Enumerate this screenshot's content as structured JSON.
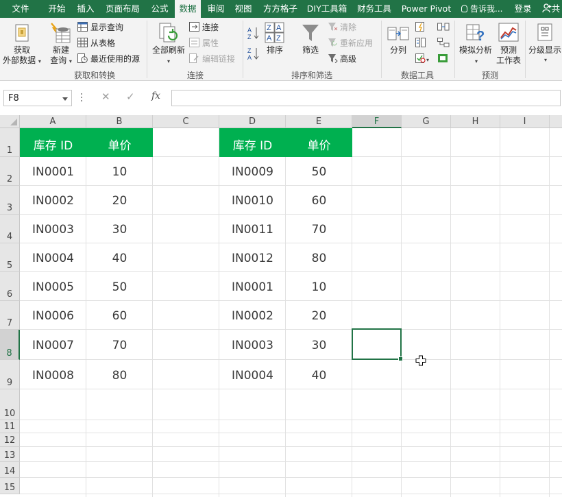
{
  "menu": {
    "tabs": [
      "文件",
      "开始",
      "插入",
      "页面布局",
      "公式",
      "数据",
      "审阅",
      "视图",
      "方方格子",
      "DIY工具箱",
      "财务工具",
      "Power Pivot"
    ],
    "active_tab": "数据",
    "tell_me": "告诉我...",
    "login": "登录",
    "share": "共"
  },
  "ribbon": {
    "get_transform": {
      "get_external": [
        "获取",
        "外部数据"
      ],
      "new_query": [
        "新建",
        "查询"
      ],
      "show_queries": "显示查询",
      "from_table": "从表格",
      "recent_sources": "最近使用的源",
      "label": "获取和转换"
    },
    "connections": {
      "refresh_all": "全部刷新",
      "connections": "连接",
      "properties": "属性",
      "edit_links": "编辑链接",
      "label": "连接"
    },
    "sort_filter": {
      "sort": "排序",
      "filter": "筛选",
      "clear": "清除",
      "reapply": "重新应用",
      "advanced": "高级",
      "label": "排序和筛选"
    },
    "data_tools": {
      "text_to_columns": "分列",
      "label": "数据工具"
    },
    "forecast": {
      "what_if": "模拟分析",
      "forecast_sheet": [
        "预测",
        "工作表"
      ],
      "label": "预测"
    },
    "outline": {
      "outline": "分级显示"
    }
  },
  "formula_bar": {
    "name_box": "F8",
    "cancel": "✕",
    "enter": "✓",
    "fx": "fx",
    "formula": ""
  },
  "sheet": {
    "columns": [
      "A",
      "B",
      "C",
      "D",
      "E",
      "F",
      "G",
      "H",
      "I"
    ],
    "rows": [
      "1",
      "2",
      "3",
      "4",
      "5",
      "6",
      "7",
      "8",
      "9",
      "10",
      "11",
      "12",
      "13",
      "14",
      "15"
    ],
    "selected_cell": "F8",
    "table1": {
      "headers": [
        "库存 ID",
        "单价"
      ],
      "rows": [
        [
          "IN0001",
          "10"
        ],
        [
          "IN0002",
          "20"
        ],
        [
          "IN0003",
          "30"
        ],
        [
          "IN0004",
          "40"
        ],
        [
          "IN0005",
          "50"
        ],
        [
          "IN0006",
          "60"
        ],
        [
          "IN0007",
          "70"
        ],
        [
          "IN0008",
          "80"
        ]
      ]
    },
    "table2": {
      "headers": [
        "库存 ID",
        "单价"
      ],
      "rows": [
        [
          "IN0009",
          "50"
        ],
        [
          "IN0010",
          "60"
        ],
        [
          "IN0011",
          "70"
        ],
        [
          "IN0012",
          "80"
        ],
        [
          "IN0001",
          "10"
        ],
        [
          "IN0002",
          "20"
        ],
        [
          "IN0003",
          "30"
        ],
        [
          "IN0004",
          "40"
        ]
      ]
    },
    "header_fill_color": "#00b050",
    "accent_color": "#217346"
  }
}
